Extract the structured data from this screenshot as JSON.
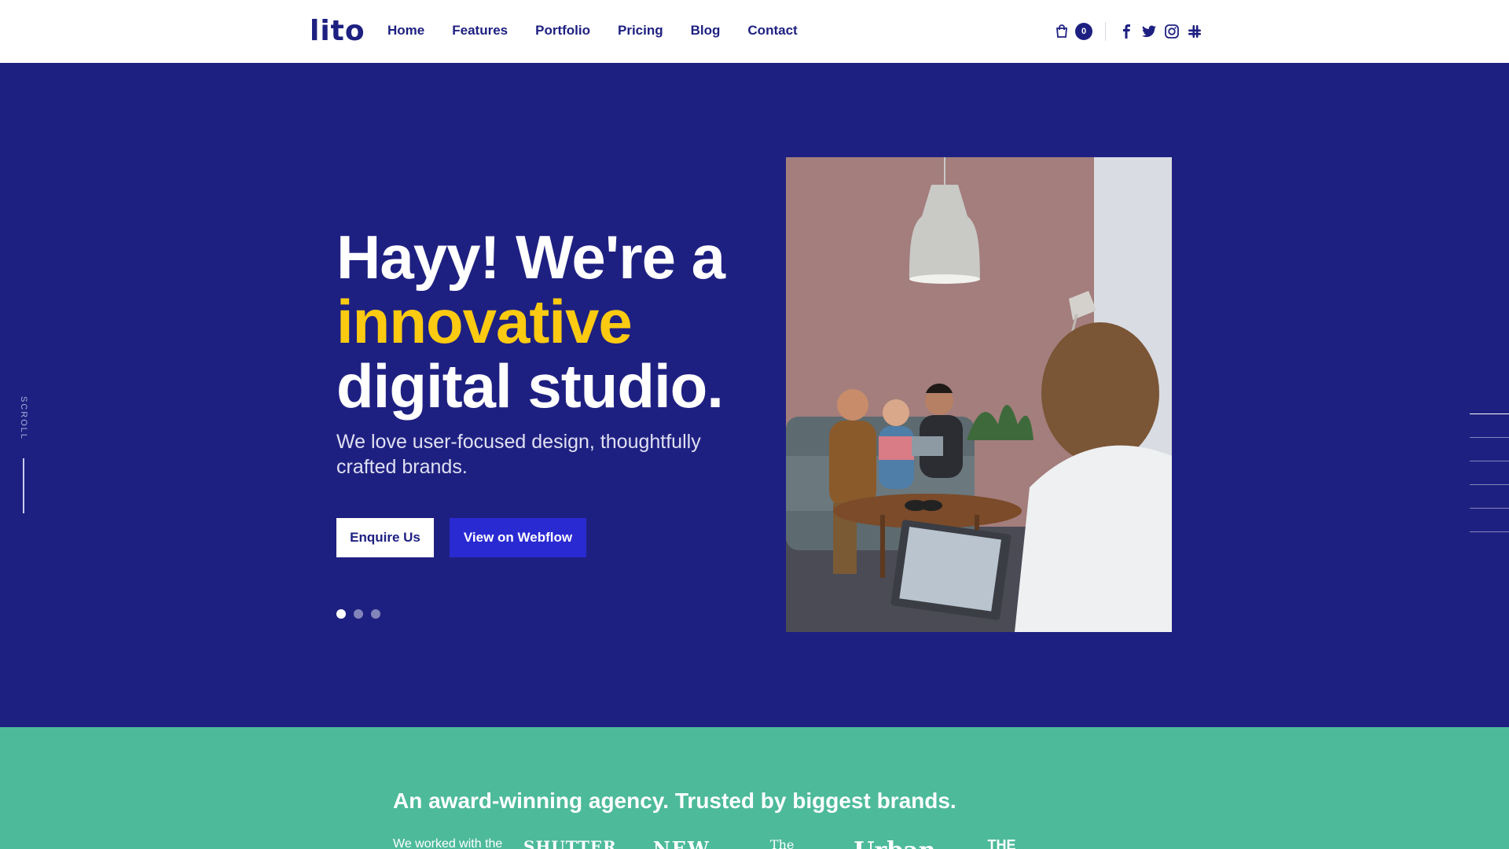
{
  "brand": {
    "logo": "lito"
  },
  "nav": {
    "items": [
      "Home",
      "Features",
      "Portfolio",
      "Pricing",
      "Blog",
      "Contact"
    ]
  },
  "header_right": {
    "cart_count": "0",
    "cart_icon": "shopping-bag-icon",
    "social_icons": [
      "facebook-icon",
      "twitter-icon",
      "instagram-icon",
      "slack-icon"
    ]
  },
  "hero": {
    "headline_line1": "Hayy! We're a",
    "headline_accent": "innovative",
    "headline_line3": "digital studio.",
    "subheading": "We love user-focused design, thoughtfully crafted brands.",
    "primary_button": "Enquire Us",
    "secondary_button": "View on Webflow",
    "slider_dots": 3,
    "active_dot": 1,
    "scroll_label": "SCROLL"
  },
  "trust": {
    "title": "An award-winning agency. Trusted by biggest brands.",
    "note": "We worked with the",
    "brands": [
      "SHUTTER",
      "NEW",
      "The",
      "Urban",
      "THE"
    ]
  },
  "colors": {
    "primary": "#1e2081",
    "accent": "#fccb11",
    "button_blue": "#2a2ad2",
    "trust_band": "#4dba9a"
  }
}
